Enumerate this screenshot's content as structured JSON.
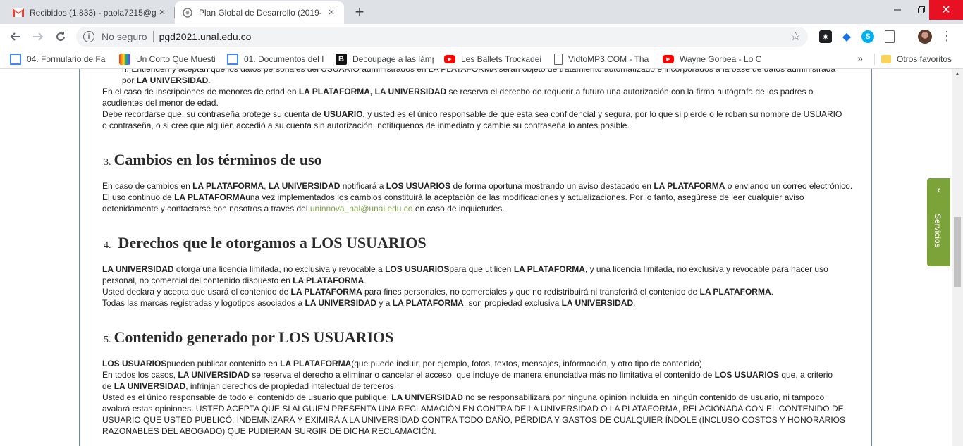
{
  "tabs": [
    {
      "title": "Recibidos (1.833) - paola7215@g",
      "icon": "gmail-icon",
      "active": false
    },
    {
      "title": "Plan Global de Desarrollo (2019-",
      "icon": "crest-icon",
      "active": true
    }
  ],
  "toolbar": {
    "security_label": "No seguro",
    "url": "pgd2021.unal.edu.co"
  },
  "bookmarks": [
    {
      "label": "04. Formulario de Fa",
      "icon": "doc-icon"
    },
    {
      "label": "Un Corto Que Muesti",
      "icon": "rainbow-icon"
    },
    {
      "label": "01. Documentos del I",
      "icon": "doc-icon"
    },
    {
      "label": "Decoupage a las lámp",
      "icon": "b-icon"
    },
    {
      "label": "Les Ballets Trockadei",
      "icon": "youtube-icon"
    },
    {
      "label": "VidtoMP3.COM - Tha",
      "icon": "page-icon"
    },
    {
      "label": "Wayne Gorbea - Lo C",
      "icon": "youtube-icon"
    }
  ],
  "bookmarks_more": "»",
  "other_favorites": "Otros favoritos",
  "page": {
    "cut_line": "h. Entienden y aceptan que los datos personales del USUARIO administrados en LA PLATAFORMA serán objeto de tratamiento automatizado e incorporados a la base de datos administrada",
    "cut_line_end_pre": "por ",
    "cut_line_end_b": "LA UNIVERSIDAD",
    "cut_line_end_post": ".",
    "p1a": "En el caso de inscripciones de menores de edad en ",
    "p1b": "LA PLATAFORMA, LA UNIVERSIDAD",
    "p1c": " se reserva el derecho de requerir a futuro una autorización con la firma autógrafa de los padres o",
    "p1d": "acudientes del menor de edad.",
    "p2a": "Debe recordarse que, su contraseña protege su cuenta de ",
    "p2b": "USUARIO,",
    "p2c": " y usted es el único responsable de que esta sea confidencial y segura, por lo que si pierde o le roban su nombre de USUARIO",
    "p2d": "o contraseña, o si cree que alguien accedió a su cuenta sin autorización, notifíquenos de inmediato y cambie su contraseña lo antes posible.",
    "s3_num": "3.",
    "s3_title": "Cambios en los términos de uso",
    "s3a": "En caso de cambios en ",
    "s3b": "LA PLATAFORMA",
    "s3c": ", ",
    "s3d": "LA UNIVERSIDAD",
    "s3e": " notificará a ",
    "s3f": "LOS USUARIOS",
    "s3g": " de forma oportuna mostrando un aviso destacado en ",
    "s3h": "LA PLATAFORMA",
    "s3i": " o enviando un correo electrónico.",
    "s3j": " El uso continuo de ",
    "s3k": "LA PLATAFORMA",
    "s3l": "una vez implementados los cambios constituirá la aceptación de las modificaciones y actualizaciones. Por lo tanto, asegúrese de leer cualquier aviso",
    "s3m": "detenidamente y contactarse con nosotros a través del ",
    "s3_email": "uninnova_nal@unal.edu.co",
    "s3n": " en caso de inquietudes.",
    "s4_num": "4.",
    "s4_title": "Derechos que le otorgamos a LOS USUARIOS",
    "s4a": "LA UNIVERSIDAD",
    "s4b": " otorga una licencia limitada, no exclusiva y revocable a ",
    "s4c": "LOS USUARIOS",
    "s4d": "para que utilicen ",
    "s4e": "LA PLATAFORMA",
    "s4f": ", y una licencia limitada, no exclusiva y revocable para hacer uso",
    "s4g": "personal, no comercial del contenido dispuesto en ",
    "s4h": "LA PLATAFORMA",
    "s4i": ".",
    "s4j": "Usted declara y acepta que usará el contenido de ",
    "s4k": "LA PLATAFORMA",
    "s4l": " para fines personales, no comerciales y que no redistribuirá ni transferirá el contenido de ",
    "s4m": "LA PLATAFORMA",
    "s4n": ".",
    "s4o": "Todas las marcas registradas y logotipos asociados a ",
    "s4p": "LA UNIVERSIDAD",
    "s4q": " y a ",
    "s4r": "LA PLATAFORMA",
    "s4s": ", son propiedad exclusiva ",
    "s4t": "LA UNIVERSIDAD",
    "s4u": ".",
    "s5_num": "5.",
    "s5_title": "Contenido generado por LOS USUARIOS",
    "s5a": "LOS USUARIOS",
    "s5b": "pueden publicar contenido en ",
    "s5c": "LA PLATAFORMA",
    "s5d": "(que puede incluir, por ejemplo, fotos, textos, mensajes, información, y otro tipo de contenido)",
    "s5e": "En todos los casos, ",
    "s5f": "LA UNIVERSIDAD",
    "s5g": " se reserva el derecho a eliminar o cancelar el acceso, que incluye de manera enunciativa más no limitativa el contenido de ",
    "s5h": "LOS USUARIOS",
    "s5i": " que, a criterio",
    "s5j": "de ",
    "s5k": "LA UNIVERSIDAD",
    "s5l": ", infrinjan derechos de propiedad intelectual de terceros.",
    "s5m": "Usted es el único responsable de todo el contenido de usuario que publique. ",
    "s5n": "LA UNIVERSIDAD",
    "s5o": " no se responsabilizará por ninguna opinión incluida en ningún contenido de usuario, ni tampoco",
    "s5p": "avalará estas opiniones. USTED ACEPTA QUE SI ALGUIEN PRESENTA UNA RECLAMACIÓN EN CONTRA DE LA UNIVERSIDAD O LA PLATAFORMA, RELACIONADA CON EL CONTENIDO DE",
    "s5q": "USUARIO QUE USTED PUBLICÓ, INDEMNIZARÁ Y EXIMIRÁ A LA UNIVERSIDAD CONTRA TODO DAÑO, PÉRDIDA Y GASTOS DE CUALQUIER ÍNDOLE (INCLUSO COSTOS Y HONORARIOS",
    "s5r": "RAZONABLES DEL ABOGADO) QUE PUDIERAN SURGIR DE DICHA RECLAMACIÓN."
  },
  "side_tab": {
    "label": "Servicios",
    "icon": "chevron-left-icon"
  },
  "colors": {
    "accent_green": "#7ca33a",
    "link": "#7fa34a",
    "border_blue": "#6b86c2",
    "close_red": "#e81123"
  }
}
